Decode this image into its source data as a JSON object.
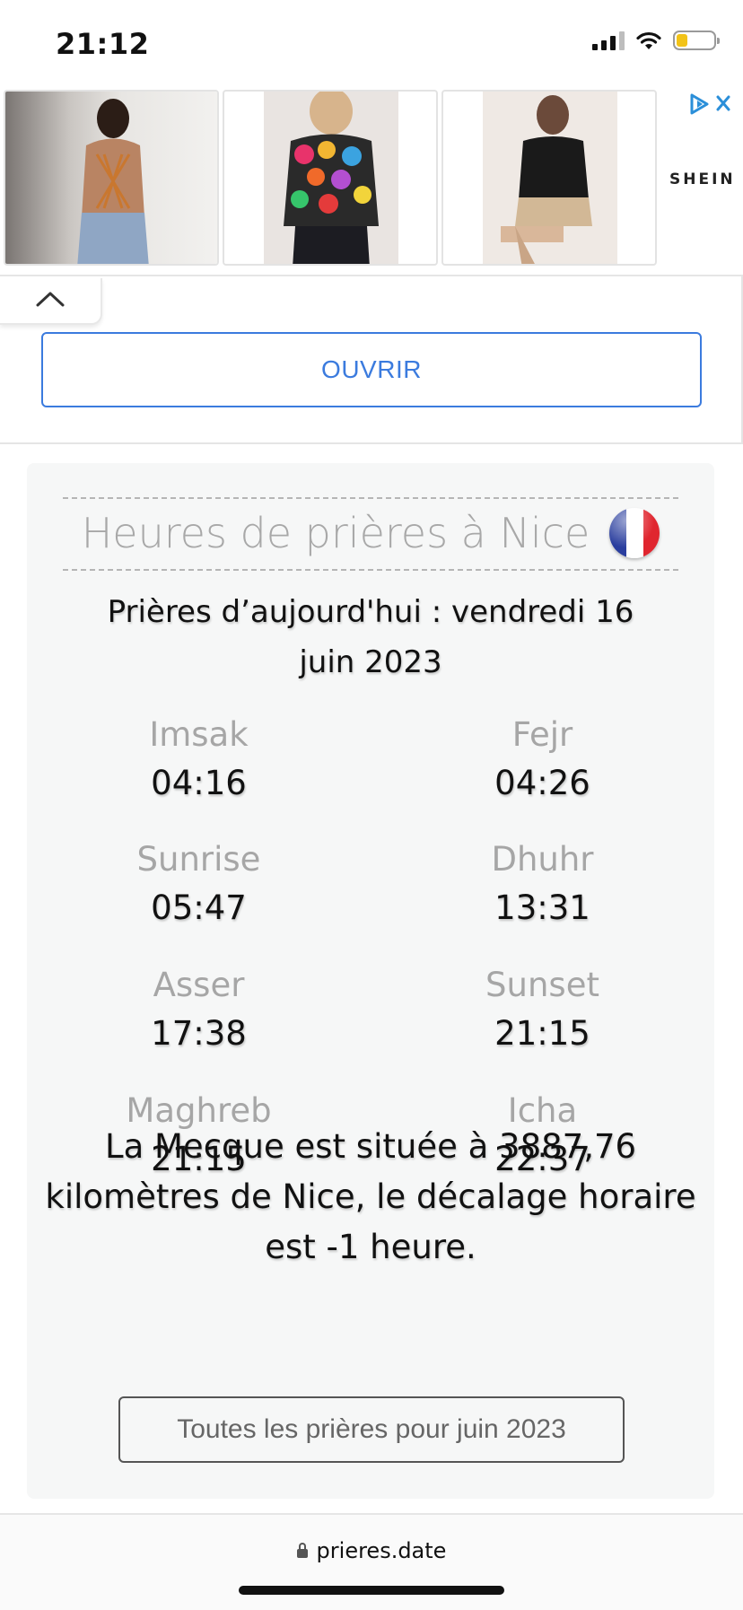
{
  "status_bar": {
    "time": "21:12"
  },
  "ad": {
    "brand": "SHEIN",
    "open_label": "OUVRIR"
  },
  "card": {
    "title": "Heures de prières à Nice",
    "date_line": "Prières d’aujourd'hui : vendredi 16 juin 2023",
    "prayers": [
      {
        "name": "Imsak",
        "time": "04:16"
      },
      {
        "name": "Fejr",
        "time": "04:26"
      },
      {
        "name": "Sunrise",
        "time": "05:47"
      },
      {
        "name": "Dhuhr",
        "time": "13:31"
      },
      {
        "name": "Asser",
        "time": "17:38"
      },
      {
        "name": "Sunset",
        "time": "21:15"
      },
      {
        "name": "Maghreb",
        "time": "21:15"
      },
      {
        "name": "Icha",
        "time": "22:37"
      }
    ],
    "info": "La Mecque est située à 3887,76 kilomètres de Nice, le décalage horaire est -1 heure.",
    "month_button": "Toutes les prières pour juin 2023"
  },
  "browser": {
    "url": "prieres.date"
  },
  "colors": {
    "accent_blue": "#3b7bde",
    "card_bg": "#f6f7f7",
    "label_gray": "#a6a6a6",
    "battery_yellow": "#f2c318"
  },
  "icons": {
    "cellular": "cellular-signal-icon",
    "wifi": "wifi-icon",
    "battery": "battery-icon",
    "adchoices": "adchoices-icon",
    "close": "close-icon",
    "collapse": "chevron-up-icon",
    "flag": "france-flag-icon",
    "lock": "lock-icon"
  },
  "battery_level": 0.2
}
